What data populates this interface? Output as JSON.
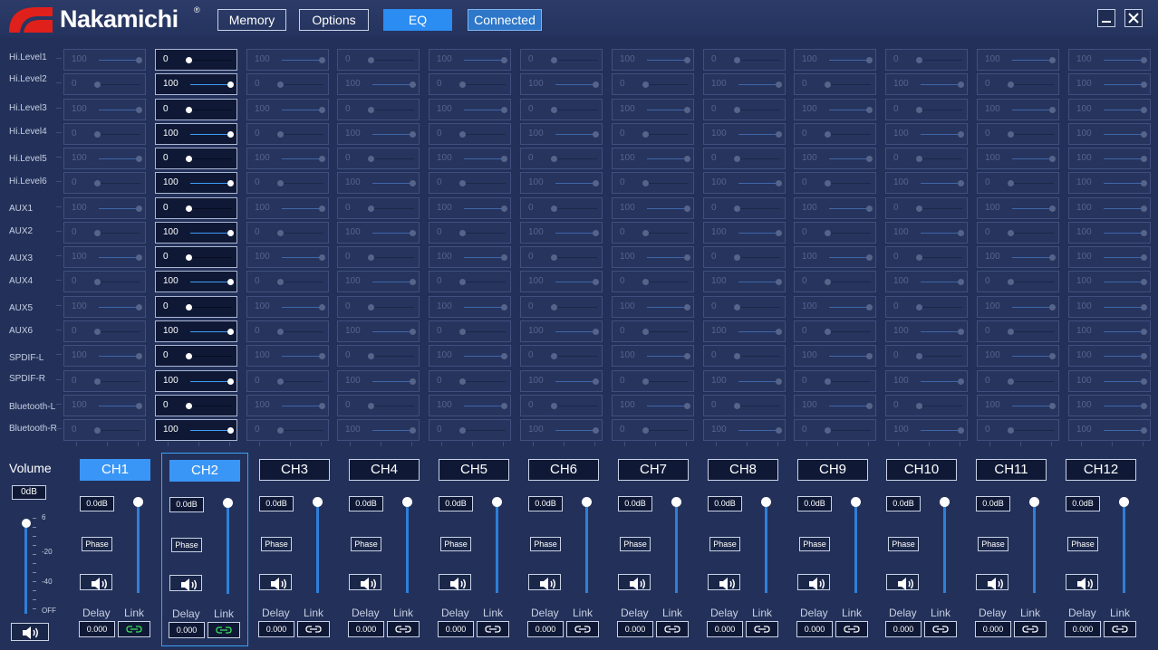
{
  "brand": {
    "name": "Nakamichi",
    "reg": "®"
  },
  "header": {
    "buttons": [
      {
        "label": "Memory"
      },
      {
        "label": "Options"
      },
      {
        "label": "EQ"
      }
    ],
    "status": "Connected",
    "minimize_icon": "minimize-icon",
    "close_icon": "close-icon"
  },
  "matrix": {
    "rows": [
      "Hi.Level1",
      "Hi.Level2",
      "Hi.Level3",
      "Hi.Level4",
      "Hi.Level5",
      "Hi.Level6",
      "AUX1",
      "AUX2",
      "AUX3",
      "AUX4",
      "AUX5",
      "AUX6",
      "SPDIF-L",
      "SPDIF-R",
      "Bluetooth-L",
      "Bluetooth-R"
    ],
    "active_channel": 2,
    "cells": [
      [
        "100",
        "0",
        "100",
        "0",
        "100",
        "0",
        "100",
        "0",
        "100",
        "0",
        "100",
        "100"
      ],
      [
        "0",
        "100",
        "0",
        "100",
        "0",
        "100",
        "0",
        "100",
        "0",
        "100",
        "0",
        "100"
      ],
      [
        "100",
        "0",
        "100",
        "0",
        "100",
        "0",
        "100",
        "0",
        "100",
        "0",
        "100",
        "100"
      ],
      [
        "0",
        "100",
        "0",
        "100",
        "0",
        "100",
        "0",
        "100",
        "0",
        "100",
        "0",
        "100"
      ],
      [
        "100",
        "0",
        "100",
        "0",
        "100",
        "0",
        "100",
        "0",
        "100",
        "0",
        "100",
        "100"
      ],
      [
        "0",
        "100",
        "0",
        "100",
        "0",
        "100",
        "0",
        "100",
        "0",
        "100",
        "0",
        "100"
      ],
      [
        "100",
        "0",
        "100",
        "0",
        "100",
        "0",
        "100",
        "0",
        "100",
        "0",
        "100",
        "100"
      ],
      [
        "0",
        "100",
        "0",
        "100",
        "0",
        "100",
        "0",
        "100",
        "0",
        "100",
        "0",
        "100"
      ],
      [
        "100",
        "0",
        "100",
        "0",
        "100",
        "0",
        "100",
        "0",
        "100",
        "0",
        "100",
        "100"
      ],
      [
        "0",
        "100",
        "0",
        "100",
        "0",
        "100",
        "0",
        "100",
        "0",
        "100",
        "0",
        "100"
      ],
      [
        "100",
        "0",
        "100",
        "0",
        "100",
        "0",
        "100",
        "0",
        "100",
        "0",
        "100",
        "100"
      ],
      [
        "0",
        "100",
        "0",
        "100",
        "0",
        "100",
        "0",
        "100",
        "0",
        "100",
        "0",
        "100"
      ],
      [
        "100",
        "0",
        "100",
        "0",
        "100",
        "0",
        "100",
        "0",
        "100",
        "0",
        "100",
        "100"
      ],
      [
        "0",
        "100",
        "0",
        "100",
        "0",
        "100",
        "0",
        "100",
        "0",
        "100",
        "0",
        "100"
      ],
      [
        "100",
        "0",
        "100",
        "0",
        "100",
        "0",
        "100",
        "0",
        "100",
        "0",
        "100",
        "100"
      ],
      [
        "0",
        "100",
        "0",
        "100",
        "0",
        "100",
        "0",
        "100",
        "0",
        "100",
        "0",
        "100"
      ]
    ]
  },
  "volume": {
    "title": "Volume",
    "value": "0dB",
    "level": 1.0,
    "scale": [
      "6",
      "-20",
      "-40",
      "OFF"
    ],
    "mute_icon": "speaker-icon"
  },
  "channels": [
    {
      "name": "CH1",
      "gain": "0.0dB",
      "phase": "Phase",
      "delay_label": "Delay",
      "link_label": "Link",
      "delay": "0.000",
      "link_on": true,
      "selected": false,
      "active": true,
      "level": 1.0
    },
    {
      "name": "CH2",
      "gain": "0.0dB",
      "phase": "Phase",
      "delay_label": "Delay",
      "link_label": "Link",
      "delay": "0.000",
      "link_on": true,
      "selected": true,
      "active": true,
      "level": 1.0
    },
    {
      "name": "CH3",
      "gain": "0.0dB",
      "phase": "Phase",
      "delay_label": "Delay",
      "link_label": "Link",
      "delay": "0.000",
      "link_on": false,
      "selected": false,
      "active": false,
      "level": 1.0
    },
    {
      "name": "CH4",
      "gain": "0.0dB",
      "phase": "Phase",
      "delay_label": "Delay",
      "link_label": "Link",
      "delay": "0.000",
      "link_on": false,
      "selected": false,
      "active": false,
      "level": 1.0
    },
    {
      "name": "CH5",
      "gain": "0.0dB",
      "phase": "Phase",
      "delay_label": "Delay",
      "link_label": "Link",
      "delay": "0.000",
      "link_on": false,
      "selected": false,
      "active": false,
      "level": 1.0
    },
    {
      "name": "CH6",
      "gain": "0.0dB",
      "phase": "Phase",
      "delay_label": "Delay",
      "link_label": "Link",
      "delay": "0.000",
      "link_on": false,
      "selected": false,
      "active": false,
      "level": 1.0
    },
    {
      "name": "CH7",
      "gain": "0.0dB",
      "phase": "Phase",
      "delay_label": "Delay",
      "link_label": "Link",
      "delay": "0.000",
      "link_on": false,
      "selected": false,
      "active": false,
      "level": 1.0
    },
    {
      "name": "CH8",
      "gain": "0.0dB",
      "phase": "Phase",
      "delay_label": "Delay",
      "link_label": "Link",
      "delay": "0.000",
      "link_on": false,
      "selected": false,
      "active": false,
      "level": 1.0
    },
    {
      "name": "CH9",
      "gain": "0.0dB",
      "phase": "Phase",
      "delay_label": "Delay",
      "link_label": "Link",
      "delay": "0.000",
      "link_on": false,
      "selected": false,
      "active": false,
      "level": 1.0
    },
    {
      "name": "CH10",
      "gain": "0.0dB",
      "phase": "Phase",
      "delay_label": "Delay",
      "link_label": "Link",
      "delay": "0.000",
      "link_on": false,
      "selected": false,
      "active": false,
      "level": 1.0
    },
    {
      "name": "CH11",
      "gain": "0.0dB",
      "phase": "Phase",
      "delay_label": "Delay",
      "link_label": "Link",
      "delay": "0.000",
      "link_on": false,
      "selected": false,
      "active": false,
      "level": 1.0
    },
    {
      "name": "CH12",
      "gain": "0.0dB",
      "phase": "Phase",
      "delay_label": "Delay",
      "link_label": "Link",
      "delay": "0.000",
      "link_on": false,
      "selected": false,
      "active": false,
      "level": 1.0
    }
  ],
  "icons": {
    "link": "link-icon",
    "speaker": "speaker-icon"
  },
  "colors": {
    "accent": "#3a96f6",
    "link_on": "#3ee060",
    "background": "#23315a"
  }
}
